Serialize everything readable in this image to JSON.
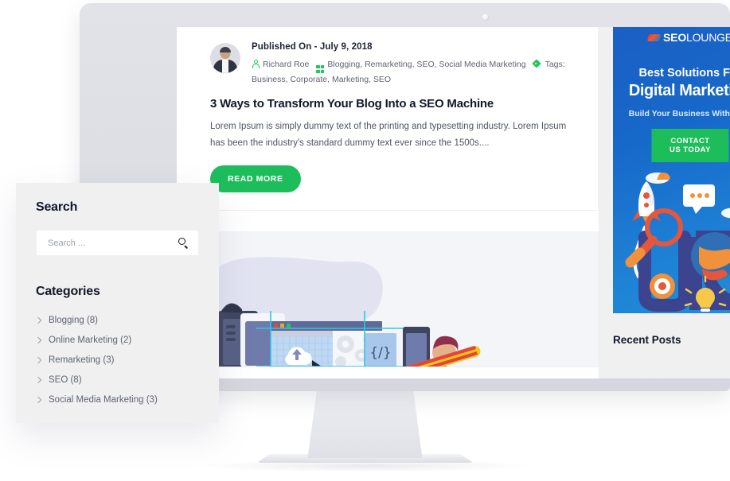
{
  "device": {
    "label": "desktop-monitor-mockup",
    "bezel_color": "#dcdde3",
    "screen_color": "#ffffff"
  },
  "post": {
    "published_label": "Published On - July 9, 2018",
    "author_icon": "user-icon",
    "author": "Richard Roe",
    "categories_icon": "grid-icon",
    "categories": "Blogging, Remarketing, SEO, Social Media Marketing",
    "tags_icon": "tag-icon",
    "tags_label": "Tags:",
    "tags": "Business, Corporate, Marketing, SEO",
    "title": "3 Ways to Transform Your Blog Into a SEO Machine",
    "excerpt": "Lorem Ipsum is simply dummy text of the printing and typesetting industry. Lorem Ipsum has been the industry's standard dummy text ever since the 1500s....",
    "read_more_label": "READ MORE",
    "accent_green": "#1ebd5b"
  },
  "second_post": {
    "illustration_name": "web-development-illustration"
  },
  "aside": {
    "ad": {
      "logo_bold": "SEO",
      "logo_light": "LOUNGE",
      "line1": "Best Solutions For",
      "line2": "Digital Marketing",
      "line3": "Build Your Business With Easy",
      "cta_label": "CONTACT US TODAY",
      "artwork_name": "seo-illustration",
      "bg_color": "#1668c9",
      "cta_color": "#1ebd5b"
    },
    "recent_posts_title": "Recent Posts"
  },
  "search_panel": {
    "title": "Search",
    "placeholder": "Search ...",
    "value": "",
    "search_icon": "search-icon",
    "categories_title": "Categories",
    "categories": [
      {
        "label": "Blogging (8)"
      },
      {
        "label": "Online Marketing (2)"
      },
      {
        "label": "Remarketing (3)"
      },
      {
        "label": "SEO (8)"
      },
      {
        "label": "Social Media Marketing (3)"
      }
    ]
  }
}
